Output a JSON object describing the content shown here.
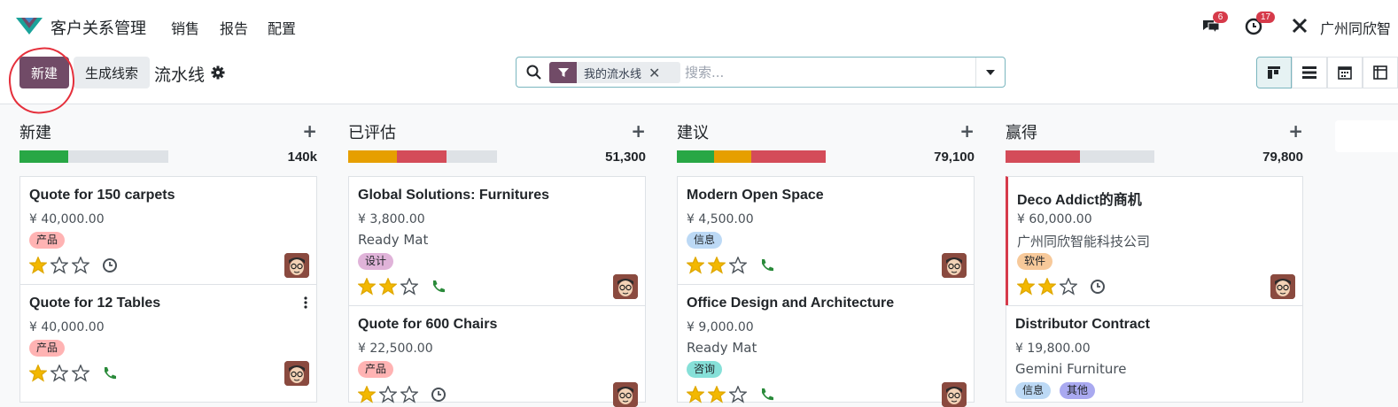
{
  "app": {
    "name": "客户关系管理",
    "menu": [
      "销售",
      "报告",
      "配置"
    ],
    "company": "广州同欣智",
    "chat_count": "6",
    "activity_count": "17"
  },
  "controls": {
    "new_label": "新建",
    "generate_label": "生成线索",
    "breadcrumb": "流水线"
  },
  "search": {
    "facet": "我的流水线",
    "facet_remove": "✕",
    "placeholder": "搜索..."
  },
  "views": [
    "kanban",
    "list",
    "calendar",
    "pivot"
  ],
  "colors": {
    "primary": "#714b67",
    "success": "#28a745",
    "warning": "#e69f00",
    "danger": "#d44c59",
    "annotation": "#e5303c"
  },
  "columns": [
    {
      "title": "新建",
      "total": "140k",
      "add": "+",
      "progress": [
        {
          "color": "#28a745",
          "fraction": 0.33
        }
      ],
      "cards": [
        {
          "title": "Quote for 150 carpets",
          "amount": "¥ 40,000.00",
          "tags": [
            {
              "label": "产品",
              "color": "#ffb3b3"
            }
          ],
          "stars": 1,
          "activity": "clock-icon"
        },
        {
          "title": "Quote for 12 Tables",
          "amount": "¥ 40,000.00",
          "tags": [
            {
              "label": "产品",
              "color": "#ffb3b3"
            }
          ],
          "stars": 1,
          "activity": "phone-icon"
        }
      ]
    },
    {
      "title": "已评估",
      "total": "51,300",
      "add": "+",
      "progress": [
        {
          "color": "#e69f00",
          "fraction": 0.33
        },
        {
          "color": "#d44c59",
          "fraction": 0.33
        }
      ],
      "cards": [
        {
          "title": "Global Solutions: Furnitures",
          "amount": "¥ 3,800.00",
          "partner": "Ready Mat",
          "tags": [
            {
              "label": "设计",
              "color": "#e0b3d9"
            }
          ],
          "stars": 2,
          "activity": "phone-icon"
        },
        {
          "title": "Quote for 600 Chairs",
          "amount": "¥ 22,500.00",
          "tags": [
            {
              "label": "产品",
              "color": "#ffb3b3"
            }
          ],
          "stars": 1,
          "activity": "clock-icon"
        }
      ]
    },
    {
      "title": "建议",
      "total": "79,100",
      "add": "+",
      "progress": [
        {
          "color": "#28a745",
          "fraction": 0.25
        },
        {
          "color": "#e69f00",
          "fraction": 0.25
        },
        {
          "color": "#d44c59",
          "fraction": 0.5
        }
      ],
      "cards": [
        {
          "title": "Modern Open Space",
          "amount": "¥ 4,500.00",
          "tags": [
            {
              "label": "信息",
              "color": "#bcd9f5"
            }
          ],
          "stars": 2,
          "activity": "phone-icon"
        },
        {
          "title": "Office Design and Architecture",
          "amount": "¥ 9,000.00",
          "partner": "Ready Mat",
          "tags": [
            {
              "label": "咨询",
              "color": "#86e0d8"
            }
          ],
          "stars": 2,
          "activity": "phone-icon"
        }
      ]
    },
    {
      "title": "赢得",
      "total": "79,800",
      "add": "+",
      "progress": [
        {
          "color": "#d44c59",
          "fraction": 0.5
        }
      ],
      "cards": [
        {
          "title": "Deco Addict的商机",
          "amount": "¥ 60,000.00",
          "partner": "广州同欣智能科技公司",
          "tags": [
            {
              "label": "软件",
              "color": "#f7c99a"
            }
          ],
          "stars": 2,
          "activity": "clock-icon"
        },
        {
          "title": "Distributor Contract",
          "amount": "¥ 19,800.00",
          "partner": "Gemini Furniture",
          "tags": [
            {
              "label": "信息",
              "color": "#bcd9f5"
            },
            {
              "label": "其他",
              "color": "#a9a9f0"
            }
          ],
          "stars": 0
        }
      ]
    }
  ]
}
